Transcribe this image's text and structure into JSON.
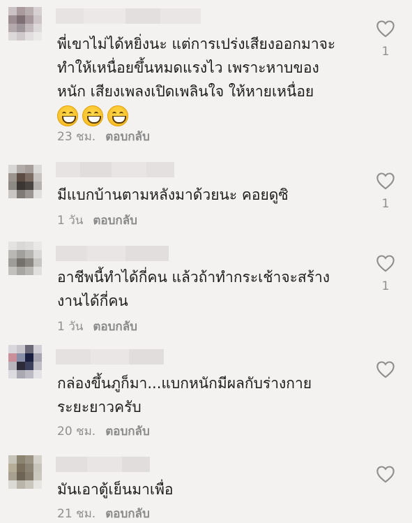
{
  "comments": [
    {
      "text_lines": [
        "พี่เขาไม่ได้หยิ่งนะ แต่การเปร่งเสียงออกมาจะ",
        "ทำให้เหนื่อยขึ้นหมดแรงไว เพราะหาบของ",
        "หนัก เสียงเพลงเปิดเพลินใจ ให้หายเหนื่อย"
      ],
      "emojis": [
        "grinning-face-emoji",
        "grinning-face-emoji",
        "grinning-face-emoji"
      ],
      "time": "23 ชม.",
      "reply": "ตอบกลับ",
      "likes": "1"
    },
    {
      "text_lines": [
        "มีแบกบ้านตามหลังมาด้วยนะ คอยดูซิ"
      ],
      "time": "1 วัน",
      "reply": "ตอบกลับ",
      "likes": "1"
    },
    {
      "text_lines": [
        "อาชีพนี้ทำได้กี่คน แล้วถ้าทำกระเช้าจะสร้าง",
        "งานได้กี่คน"
      ],
      "time": "1 วัน",
      "reply": "ตอบกลับ",
      "likes": "1"
    },
    {
      "text_lines": [
        "กล่องขึ้นภูก็มา...แบกหนักมีผลกับร่างกาย",
        "ระยะยาวครับ"
      ],
      "time": "20 ชม.",
      "reply": "ตอบกลับ",
      "likes": ""
    },
    {
      "text_lines": [
        "มันเอาตู้เย็นมาเพื่อ"
      ],
      "time": "21 ชม.",
      "reply": "ตอบกลับ",
      "likes": ""
    }
  ],
  "icons": {
    "like": "heart-outline-icon"
  },
  "colors": {
    "background": "#f3f2f0",
    "text": "#1c1c1c",
    "meta": "#8e8e8e"
  }
}
